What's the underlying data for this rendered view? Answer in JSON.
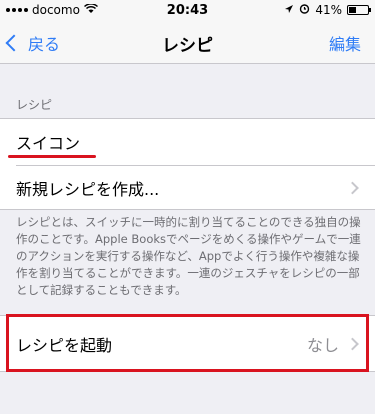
{
  "status": {
    "carrier": "docomo",
    "time": "20:43",
    "battery": "41%",
    "battery_level": 0.41
  },
  "nav": {
    "back_label": "戻る",
    "title": "レシピ",
    "edit_label": "編集"
  },
  "recipes_section": {
    "header": "レシピ",
    "items": [
      {
        "label": "スイコン"
      },
      {
        "label": "新規レシピを作成..."
      }
    ],
    "footer": "レシピとは、スイッチに一時的に割り当てることのできる独自の操作のことです。Apple Booksでページをめくる操作やゲームで一連のアクションを実行する操作など、Appでよく行う操作や複雑な操作を割り当てることができます。一連のジェスチャをレシピの一部として記録することもできます。"
  },
  "launch_section": {
    "label": "レシピを起動",
    "value": "なし"
  },
  "colors": {
    "accent": "#2f7cf6",
    "highlight": "#d9131f",
    "background": "#efeff4"
  }
}
